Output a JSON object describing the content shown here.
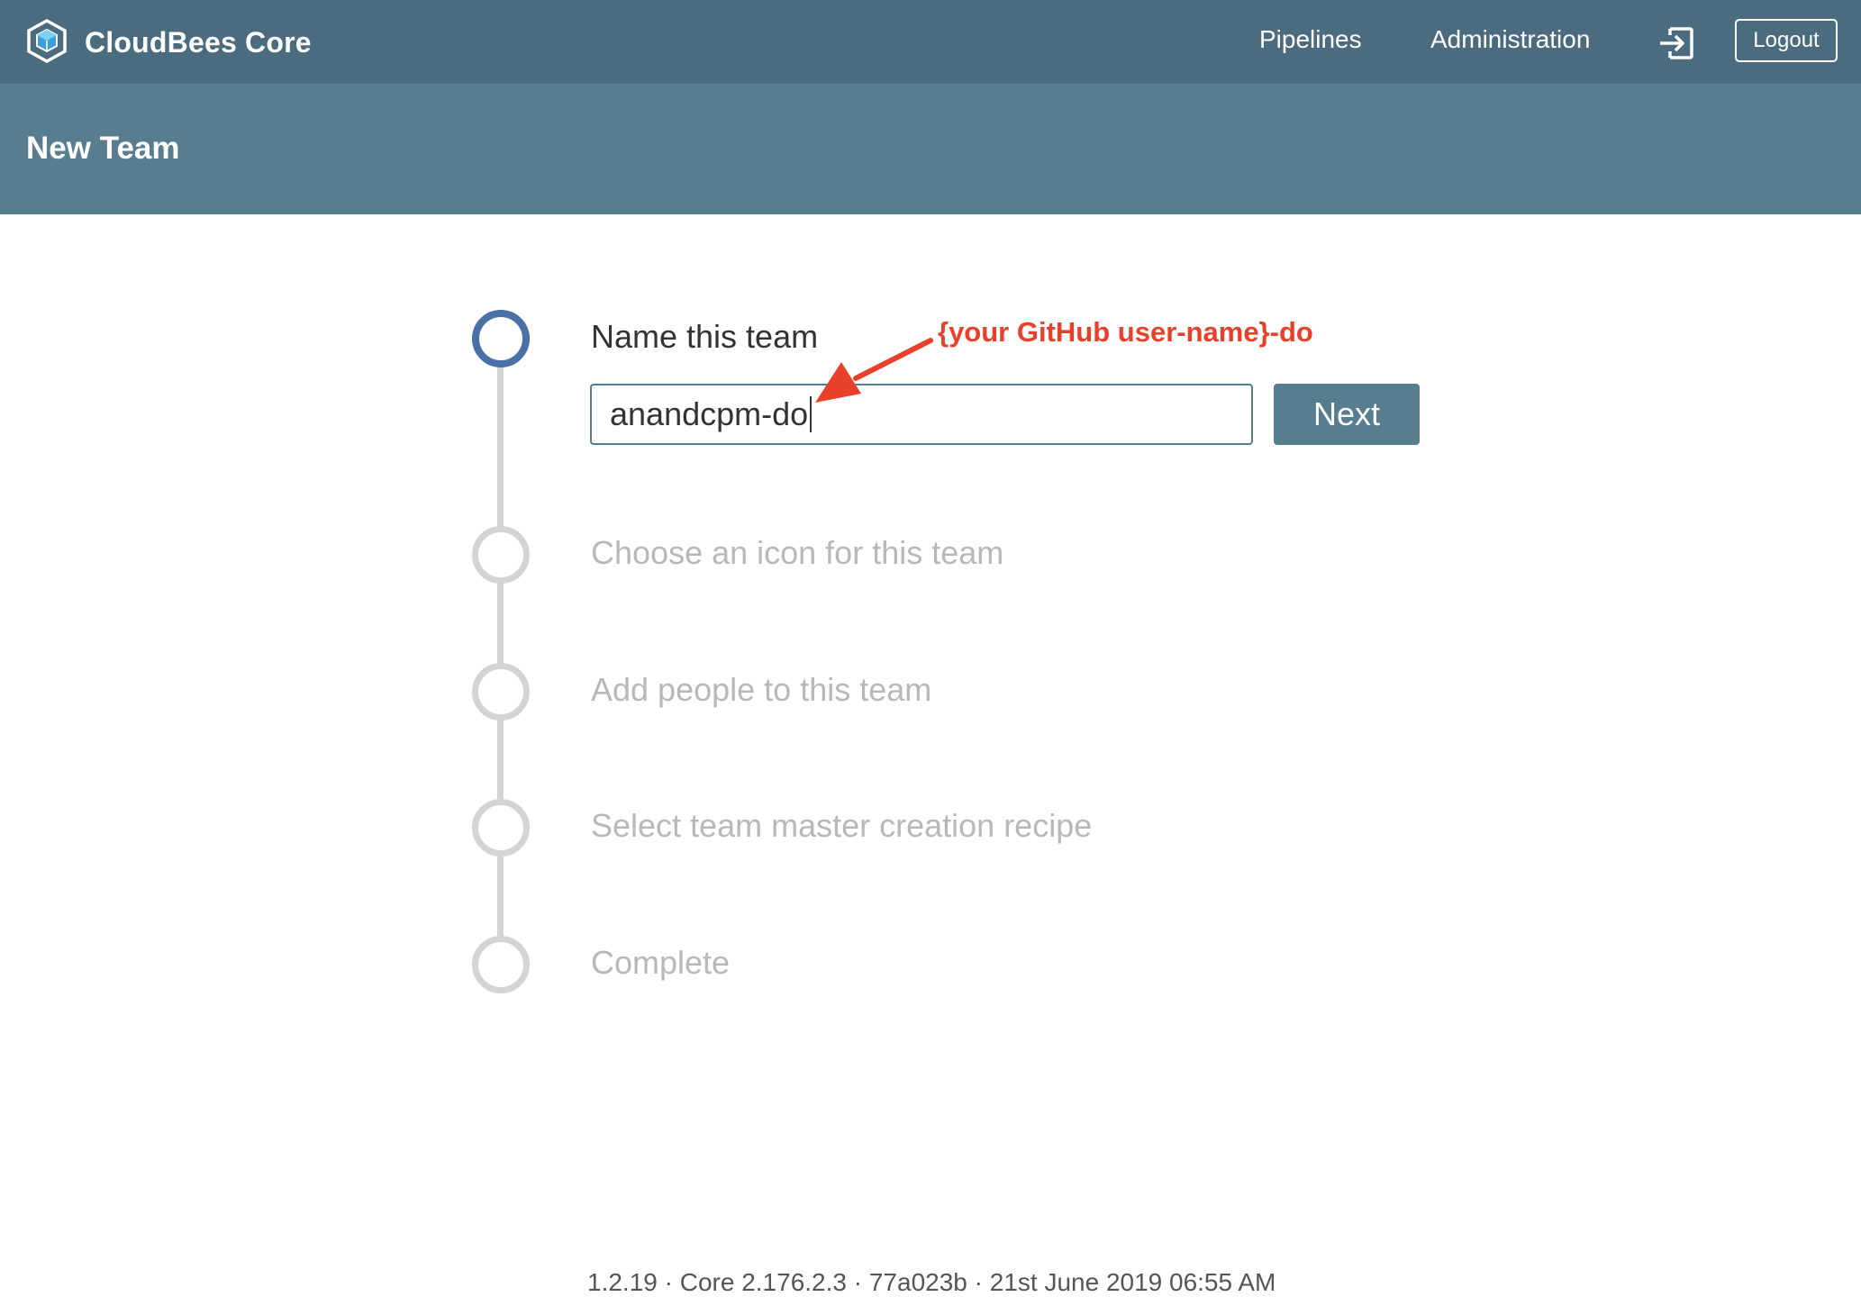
{
  "topbar": {
    "brand_name": "CloudBees Core",
    "brand_icon": "cloudbees-logo-icon",
    "nav": {
      "pipelines": "Pipelines",
      "administration": "Administration"
    },
    "signin_icon": "sign-in-icon",
    "logout_label": "Logout"
  },
  "header": {
    "title": "New Team"
  },
  "wizard": {
    "steps": [
      {
        "label": "Name this team",
        "active": true
      },
      {
        "label": "Choose an icon for this team",
        "active": false
      },
      {
        "label": "Add people to this team",
        "active": false
      },
      {
        "label": "Select team master creation recipe",
        "active": false
      },
      {
        "label": "Complete",
        "active": false
      }
    ],
    "team_name_value": "anandcpm-do",
    "next_label": "Next"
  },
  "annotation": {
    "text": "{your GitHub user-name}-do",
    "color": "#e8402a"
  },
  "footer": {
    "version": "1.2.19 · Core 2.176.2.3 · 77a023b  · 21st June 2019 06:55 AM"
  },
  "colors": {
    "topbar": "#4b6b7e",
    "subheader": "#577d8f",
    "active_step": "#4a70a8",
    "inactive_step": "#d4d4d4"
  }
}
